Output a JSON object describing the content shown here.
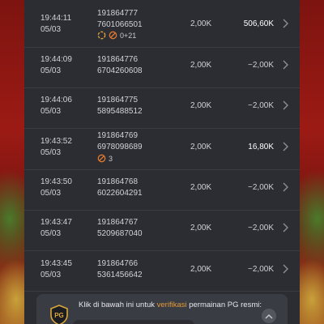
{
  "transactions": [
    {
      "time": "19:44:11",
      "date": "05/03",
      "id1": "191864777",
      "id2": "7601066501",
      "bet": "2,00K",
      "win": "506,60K",
      "positive": true,
      "badge": {
        "icons": [
          "spin-icon",
          "no-entry-icon"
        ],
        "text": "0+21"
      }
    },
    {
      "time": "19:44:09",
      "date": "05/03",
      "id1": "191864776",
      "id2": "6704260608",
      "bet": "2,00K",
      "win": "−2,00K",
      "positive": false
    },
    {
      "time": "19:44:06",
      "date": "05/03",
      "id1": "191864775",
      "id2": "5895488512",
      "bet": "2,00K",
      "win": "−2,00K",
      "positive": false
    },
    {
      "time": "19:43:52",
      "date": "05/03",
      "id1": "191864769",
      "id2": "6978098689",
      "bet": "2,00K",
      "win": "16,80K",
      "positive": true,
      "badge": {
        "icons": [
          "no-entry-icon"
        ],
        "text": "3"
      }
    },
    {
      "time": "19:43:50",
      "date": "05/03",
      "id1": "191864768",
      "id2": "6022604291",
      "bet": "2,00K",
      "win": "−2,00K",
      "positive": false
    },
    {
      "time": "19:43:47",
      "date": "05/03",
      "id1": "191864767",
      "id2": "5209687040",
      "bet": "2,00K",
      "win": "−2,00K",
      "positive": false
    },
    {
      "time": "19:43:45",
      "date": "05/03",
      "id1": "191864766",
      "id2": "5361456642",
      "bet": "2,00K",
      "win": "−2,00K",
      "positive": false
    }
  ],
  "banner": {
    "logo_text": "PG",
    "text_before": "Klik di bawah ini untuk ",
    "link": "verifikasi",
    "text_after": " permainan PG resmi:"
  },
  "colors": {
    "panel": "#2b2d33",
    "link": "#e29a38"
  }
}
